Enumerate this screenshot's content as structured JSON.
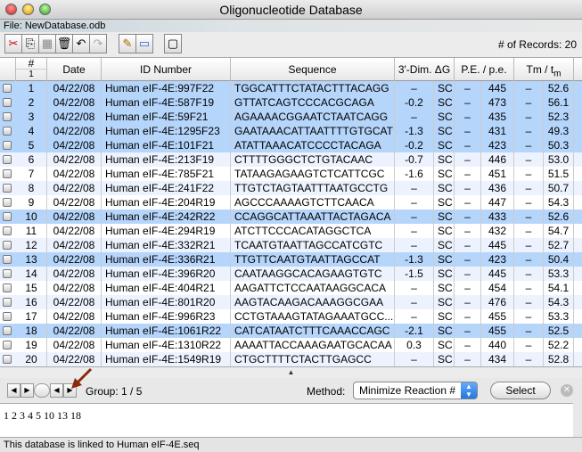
{
  "window": {
    "title": "Oligonucleotide Database",
    "file_label": "File: NewDatabase.odb"
  },
  "toolbar": {
    "records_label": "# of Records: 20",
    "buttons": [
      "cut-icon",
      "copy-icon",
      "paste-icon",
      "trash-icon",
      "undo-icon",
      "redo-icon",
      "edit-icon",
      "window-icon",
      "checkbox-icon"
    ]
  },
  "table": {
    "headers": {
      "num": "#",
      "num_sub": "1",
      "date": "Date",
      "id": "ID Number",
      "seq": "Sequence",
      "dim": "3'-Dim. ΔG",
      "pe": "P.E. / p.e.",
      "tm": "Tm / t",
      "tm_sub": "m"
    },
    "highlight_color": "#b5d5fb",
    "stripe_color": "#edf3fe",
    "rows": [
      {
        "n": "1",
        "date": "04/22/08",
        "id": "Human eIF-4E:997F22",
        "seq": "TGGCATTTCTATACTTTACAGG",
        "dg": "–",
        "sc": "SC",
        "pe": "–",
        "pev": "445",
        "tm": "–",
        "tmv": "52.6",
        "selected": true
      },
      {
        "n": "2",
        "date": "04/22/08",
        "id": "Human eIF-4E:587F19",
        "seq": "GTTATCAGTCCCACGCAGA",
        "dg": "-0.2",
        "sc": "SC",
        "pe": "–",
        "pev": "473",
        "tm": "–",
        "tmv": "56.1",
        "selected": true
      },
      {
        "n": "3",
        "date": "04/22/08",
        "id": "Human eIF-4E:59F21",
        "seq": "AGAAAACGGAATCTAATCAGG",
        "dg": "–",
        "sc": "SC",
        "pe": "–",
        "pev": "435",
        "tm": "–",
        "tmv": "52.3",
        "selected": true
      },
      {
        "n": "4",
        "date": "04/22/08",
        "id": "Human eIF-4E:1295F23",
        "seq": "GAATAAACATTAATTTTGTGCAT",
        "dg": "-1.3",
        "sc": "SC",
        "pe": "–",
        "pev": "431",
        "tm": "–",
        "tmv": "49.3",
        "selected": true
      },
      {
        "n": "5",
        "date": "04/22/08",
        "id": "Human eIF-4E:101F21",
        "seq": "ATATTAAACATCCCCTACAGA",
        "dg": "-0.2",
        "sc": "SC",
        "pe": "–",
        "pev": "423",
        "tm": "–",
        "tmv": "50.3",
        "selected": true
      },
      {
        "n": "6",
        "date": "04/22/08",
        "id": "Human eIF-4E:213F19",
        "seq": "CTTTTGGGCTCTGTACAAC",
        "dg": "-0.7",
        "sc": "SC",
        "pe": "–",
        "pev": "446",
        "tm": "–",
        "tmv": "53.0",
        "selected": false
      },
      {
        "n": "7",
        "date": "04/22/08",
        "id": "Human eIF-4E:785F21",
        "seq": "TATAAGAGAAGTCTCATTCGC",
        "dg": "-1.6",
        "sc": "SC",
        "pe": "–",
        "pev": "451",
        "tm": "–",
        "tmv": "51.5",
        "selected": false
      },
      {
        "n": "8",
        "date": "04/22/08",
        "id": "Human eIF-4E:241F22",
        "seq": "TTGTCTAGTAATTTAATGCCTG",
        "dg": "–",
        "sc": "SC",
        "pe": "–",
        "pev": "436",
        "tm": "–",
        "tmv": "50.7",
        "selected": false
      },
      {
        "n": "9",
        "date": "04/22/08",
        "id": "Human eIF-4E:204R19",
        "seq": "AGCCCAAAAGTCTTCAACA",
        "dg": "–",
        "sc": "SC",
        "pe": "–",
        "pev": "447",
        "tm": "–",
        "tmv": "54.3",
        "selected": false
      },
      {
        "n": "10",
        "date": "04/22/08",
        "id": "Human eIF-4E:242R22",
        "seq": "CCAGGCATTAAATTACTAGACA",
        "dg": "–",
        "sc": "SC",
        "pe": "–",
        "pev": "433",
        "tm": "–",
        "tmv": "52.6",
        "selected": true
      },
      {
        "n": "11",
        "date": "04/22/08",
        "id": "Human eIF-4E:294R19",
        "seq": "ATCTTCCCACATAGGCTCA",
        "dg": "–",
        "sc": "SC",
        "pe": "–",
        "pev": "432",
        "tm": "–",
        "tmv": "54.7",
        "selected": false
      },
      {
        "n": "12",
        "date": "04/22/08",
        "id": "Human eIF-4E:332R21",
        "seq": "TCAATGTAATTAGCCATCGTC",
        "dg": "–",
        "sc": "SC",
        "pe": "–",
        "pev": "445",
        "tm": "–",
        "tmv": "52.7",
        "selected": false
      },
      {
        "n": "13",
        "date": "04/22/08",
        "id": "Human eIF-4E:336R21",
        "seq": "TTGTTCAATGTAATTAGCCAT",
        "dg": "-1.3",
        "sc": "SC",
        "pe": "–",
        "pev": "423",
        "tm": "–",
        "tmv": "50.4",
        "selected": true
      },
      {
        "n": "14",
        "date": "04/22/08",
        "id": "Human eIF-4E:396R20",
        "seq": "CAATAAGGCACAGAAGTGTC",
        "dg": "-1.5",
        "sc": "SC",
        "pe": "–",
        "pev": "445",
        "tm": "–",
        "tmv": "53.3",
        "selected": false
      },
      {
        "n": "15",
        "date": "04/22/08",
        "id": "Human eIF-4E:404R21",
        "seq": "AAGATTCTCCAATAAGGCACA",
        "dg": "–",
        "sc": "SC",
        "pe": "–",
        "pev": "454",
        "tm": "–",
        "tmv": "54.1",
        "selected": false
      },
      {
        "n": "16",
        "date": "04/22/08",
        "id": "Human eIF-4E:801R20",
        "seq": "AAGTACAAGACAAAGGCGAA",
        "dg": "–",
        "sc": "SC",
        "pe": "–",
        "pev": "476",
        "tm": "–",
        "tmv": "54.3",
        "selected": false
      },
      {
        "n": "17",
        "date": "04/22/08",
        "id": "Human eIF-4E:996R23",
        "seq": "CCTGTAAAGTATAGAAATGCC...",
        "dg": "–",
        "sc": "SC",
        "pe": "–",
        "pev": "455",
        "tm": "–",
        "tmv": "53.3",
        "selected": false
      },
      {
        "n": "18",
        "date": "04/22/08",
        "id": "Human eIF-4E:1061R22",
        "seq": "CATCATAATCTTTCAAACCAGC",
        "dg": "-2.1",
        "sc": "SC",
        "pe": "–",
        "pev": "455",
        "tm": "–",
        "tmv": "52.5",
        "selected": true
      },
      {
        "n": "19",
        "date": "04/22/08",
        "id": "Human eIF-4E:1310R22",
        "seq": "AAAATTACCAAAGAATGCACAA",
        "dg": "0.3",
        "sc": "SC",
        "pe": "–",
        "pev": "440",
        "tm": "–",
        "tmv": "52.2",
        "selected": false
      },
      {
        "n": "20",
        "date": "04/22/08",
        "id": "Human eIF-4E:1549R19",
        "seq": "CTGCTTTTCTACTTGAGCC",
        "dg": "–",
        "sc": "SC",
        "pe": "–",
        "pev": "434",
        "tm": "–",
        "tmv": "52.8",
        "selected": false
      }
    ]
  },
  "controls": {
    "group_label": "Group: 1 / 5",
    "method_label": "Method:",
    "method_value": "Minimize Reaction #",
    "select_label": "Select"
  },
  "selection_text": "1  2  3  4  5  10  13  18",
  "status": "This database is linked to Human eIF-4E.seq"
}
